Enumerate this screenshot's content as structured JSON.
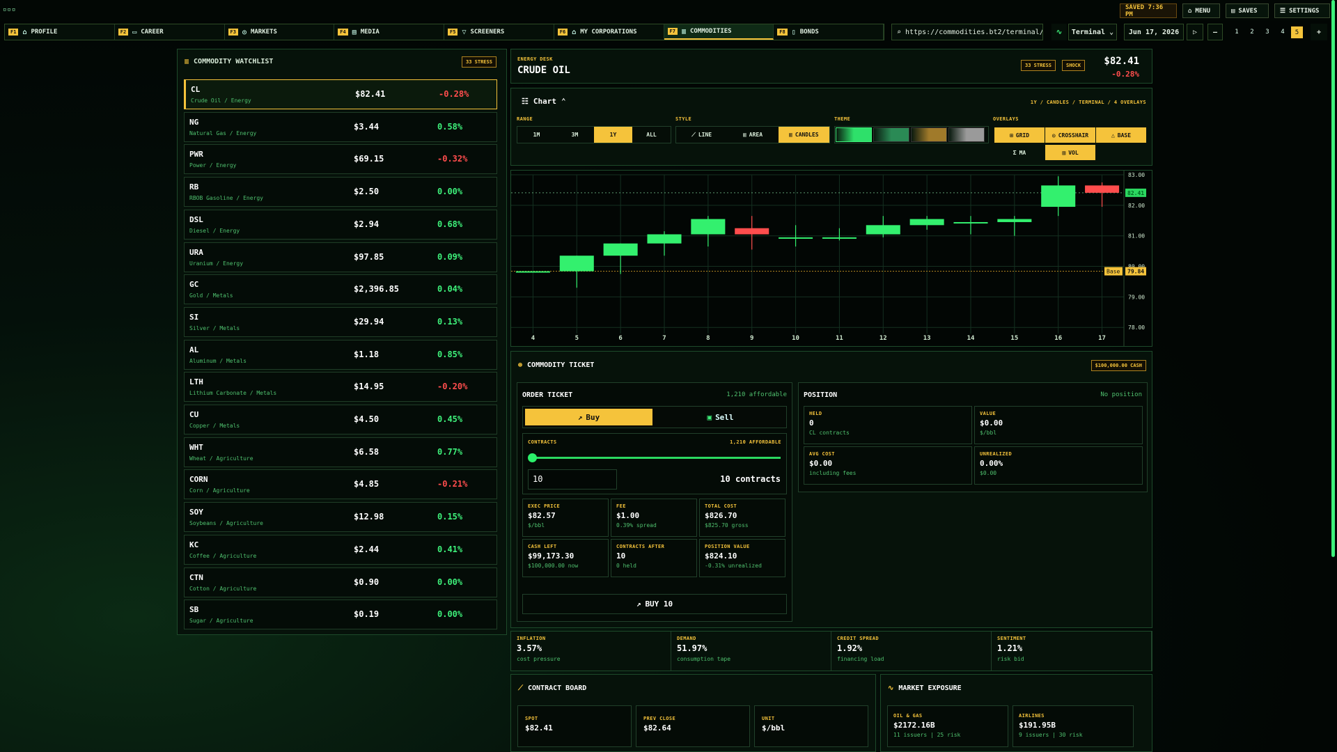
{
  "topbar": {
    "saved": "SAVED 7:36 PM",
    "menu": "MENU",
    "saves": "SAVES",
    "settings": "SETTINGS"
  },
  "tabs": [
    {
      "key": "F1",
      "label": "PROFILE",
      "icon": "home-icon"
    },
    {
      "key": "F2",
      "label": "CAREER",
      "icon": "briefcase-icon"
    },
    {
      "key": "F3",
      "label": "MARKETS",
      "icon": "globe-icon"
    },
    {
      "key": "F4",
      "label": "MEDIA",
      "icon": "newspaper-icon"
    },
    {
      "key": "F5",
      "label": "SCREENERS",
      "icon": "filter-icon"
    },
    {
      "key": "F6",
      "label": "MY CORPORATIONS",
      "icon": "bank-icon"
    },
    {
      "key": "F7",
      "label": "COMMODITIES",
      "icon": "chart-icon",
      "active": true
    },
    {
      "key": "F8",
      "label": "BONDS",
      "icon": "document-icon"
    }
  ],
  "nav": {
    "url": "https://commodities.bt2/terminal/…",
    "view_mode": "Terminal",
    "date": "Jun 17, 2026",
    "pages": [
      "1",
      "2",
      "3",
      "4",
      "5"
    ],
    "active_page": "5"
  },
  "watchlist": {
    "title": "COMMODITY WATCHLIST",
    "stress": "33 STRESS",
    "items": [
      {
        "sym": "CL",
        "name": "Crude Oil / Energy",
        "price": "$82.41",
        "chg": "-0.28%",
        "dir": "down",
        "selected": true
      },
      {
        "sym": "NG",
        "name": "Natural Gas / Energy",
        "price": "$3.44",
        "chg": "0.58%",
        "dir": "up"
      },
      {
        "sym": "PWR",
        "name": "Power / Energy",
        "price": "$69.15",
        "chg": "-0.32%",
        "dir": "down"
      },
      {
        "sym": "RB",
        "name": "RBOB Gasoline / Energy",
        "price": "$2.50",
        "chg": "0.00%",
        "dir": "up"
      },
      {
        "sym": "DSL",
        "name": "Diesel / Energy",
        "price": "$2.94",
        "chg": "0.68%",
        "dir": "up"
      },
      {
        "sym": "URA",
        "name": "Uranium / Energy",
        "price": "$97.85",
        "chg": "0.09%",
        "dir": "up"
      },
      {
        "sym": "GC",
        "name": "Gold / Metals",
        "price": "$2,396.85",
        "chg": "0.04%",
        "dir": "up"
      },
      {
        "sym": "SI",
        "name": "Silver / Metals",
        "price": "$29.94",
        "chg": "0.13%",
        "dir": "up"
      },
      {
        "sym": "AL",
        "name": "Aluminum / Metals",
        "price": "$1.18",
        "chg": "0.85%",
        "dir": "up"
      },
      {
        "sym": "LTH",
        "name": "Lithium Carbonate / Metals",
        "price": "$14.95",
        "chg": "-0.20%",
        "dir": "down"
      },
      {
        "sym": "CU",
        "name": "Copper / Metals",
        "price": "$4.50",
        "chg": "0.45%",
        "dir": "up"
      },
      {
        "sym": "WHT",
        "name": "Wheat / Agriculture",
        "price": "$6.58",
        "chg": "0.77%",
        "dir": "up"
      },
      {
        "sym": "CORN",
        "name": "Corn / Agriculture",
        "price": "$4.85",
        "chg": "-0.21%",
        "dir": "down"
      },
      {
        "sym": "SOY",
        "name": "Soybeans / Agriculture",
        "price": "$12.98",
        "chg": "0.15%",
        "dir": "up"
      },
      {
        "sym": "KC",
        "name": "Coffee / Agriculture",
        "price": "$2.44",
        "chg": "0.41%",
        "dir": "up"
      },
      {
        "sym": "CTN",
        "name": "Cotton / Agriculture",
        "price": "$0.90",
        "chg": "0.00%",
        "dir": "up"
      },
      {
        "sym": "SB",
        "name": "Sugar / Agriculture",
        "price": "$0.19",
        "chg": "0.00%",
        "dir": "up"
      }
    ]
  },
  "header": {
    "desk": "ENERGY DESK",
    "title": "CRUDE OIL",
    "stress": "33 STRESS",
    "shock": "SHOCK",
    "price": "$82.41",
    "change": "-0.28%"
  },
  "chart_controls": {
    "title": "Chart",
    "summary": "1Y / CANDLES / TERMINAL / 4 OVERLAYS",
    "range_label": "RANGE",
    "ranges": [
      "1M",
      "3M",
      "1Y",
      "ALL"
    ],
    "active_range": "1Y",
    "style_label": "STYLE",
    "styles": [
      "LINE",
      "AREA",
      "CANDLES"
    ],
    "active_style": "CANDLES",
    "theme_label": "THEME",
    "themes": [
      "#2ee06a",
      "#2a8a55",
      "#a07a2a",
      "#9a9a9a"
    ],
    "overlays_label": "OVERLAYS",
    "overlays": [
      {
        "label": "GRID",
        "on": true
      },
      {
        "label": "CROSSHAIR",
        "on": true
      },
      {
        "label": "BASE",
        "on": true
      },
      {
        "label": "MA",
        "on": false
      },
      {
        "label": "VOL",
        "on": true
      }
    ]
  },
  "chart_data": {
    "type": "candlestick",
    "x": [
      "4",
      "5",
      "6",
      "7",
      "8",
      "9",
      "10",
      "11",
      "12",
      "13",
      "14",
      "15",
      "16",
      "17"
    ],
    "open": [
      79.84,
      79.84,
      80.35,
      80.75,
      81.05,
      81.25,
      80.95,
      80.95,
      81.05,
      81.35,
      81.45,
      81.45,
      81.95,
      82.65
    ],
    "close": [
      79.84,
      80.35,
      80.75,
      81.05,
      81.55,
      81.05,
      80.95,
      80.95,
      81.35,
      81.55,
      81.45,
      81.55,
      82.65,
      82.41
    ],
    "high": [
      79.84,
      80.35,
      80.75,
      81.15,
      81.65,
      81.65,
      81.35,
      81.25,
      81.65,
      81.65,
      81.65,
      81.65,
      82.95,
      82.75
    ],
    "low": [
      79.84,
      79.3,
      79.75,
      80.35,
      80.65,
      80.55,
      80.65,
      80.85,
      80.95,
      81.2,
      81.05,
      81.0,
      81.65,
      81.95
    ],
    "ylim": [
      77.8,
      83.0
    ],
    "yticks": [
      "78.00",
      "79.00",
      "80.00",
      "81.00",
      "82.00",
      "83.00"
    ],
    "last": 82.41,
    "last_label": "82.41",
    "base": 79.84,
    "base_label": "79.84",
    "base_text": "Base",
    "grid": true,
    "colors": {
      "up": "#33f06e",
      "down": "#ff4d4d"
    }
  },
  "ticket": {
    "title": "COMMODITY TICKET",
    "cash": "$100,000.00 CASH",
    "order_title": "ORDER TICKET",
    "affordable": "1,210 affordable",
    "buy": "Buy",
    "sell": "Sell",
    "contracts_label": "CONTRACTS",
    "contracts_aff": "1,210 AFFORDABLE",
    "slider_fraction": 0.008,
    "qty": "10",
    "qty_text": "10 contracts",
    "stats": [
      {
        "label": "EXEC PRICE",
        "value": "$82.57",
        "sub": "$/bbl",
        "green": false
      },
      {
        "label": "FEE",
        "value": "$1.00",
        "sub": "0.39% spread",
        "green": false
      },
      {
        "label": "TOTAL COST",
        "value": "$826.70",
        "sub": "$825.70 gross",
        "green": false
      },
      {
        "label": "CASH LEFT",
        "value": "$99,173.30",
        "sub": "$100,000.00 now",
        "green": true
      },
      {
        "label": "CONTRACTS AFTER",
        "value": "10",
        "sub": "0 held",
        "green": false
      },
      {
        "label": "POSITION VALUE",
        "value": "$824.10",
        "sub": "-0.31% unrealized",
        "green": false
      }
    ],
    "submit": "BUY 10"
  },
  "position": {
    "title": "POSITION",
    "status": "No position",
    "cells": [
      {
        "label": "HELD",
        "value": "0",
        "sub": "CL contracts",
        "green": false
      },
      {
        "label": "VALUE",
        "value": "$0.00",
        "sub": "$/bbl",
        "green": false
      },
      {
        "label": "AVG COST",
        "value": "$0.00",
        "sub": "including fees",
        "green": false
      },
      {
        "label": "UNREALIZED",
        "value": "0.00%",
        "sub": "$0.00",
        "green": true
      }
    ]
  },
  "macro": [
    {
      "label": "INFLATION",
      "value": "3.57%",
      "sub": "cost pressure",
      "green": false
    },
    {
      "label": "DEMAND",
      "value": "51.97%",
      "sub": "consumption tape",
      "green": false
    },
    {
      "label": "CREDIT SPREAD",
      "value": "1.92%",
      "sub": "financing load",
      "green": false
    },
    {
      "label": "SENTIMENT",
      "value": "1.21%",
      "sub": "risk bid",
      "green": true
    }
  ],
  "board": {
    "title": "CONTRACT BOARD",
    "cells": [
      {
        "label": "SPOT",
        "value": "$82.41"
      },
      {
        "label": "PREV CLOSE",
        "value": "$82.64"
      },
      {
        "label": "UNIT",
        "value": "$/bbl"
      }
    ]
  },
  "exposure": {
    "title": "MARKET EXPOSURE",
    "cells": [
      {
        "label": "OIL & GAS",
        "value": "$2172.16B",
        "sub": "11 issuers | 25 risk"
      },
      {
        "label": "AIRLINES",
        "value": "$191.95B",
        "sub": "9 issuers | 30 risk"
      }
    ]
  }
}
